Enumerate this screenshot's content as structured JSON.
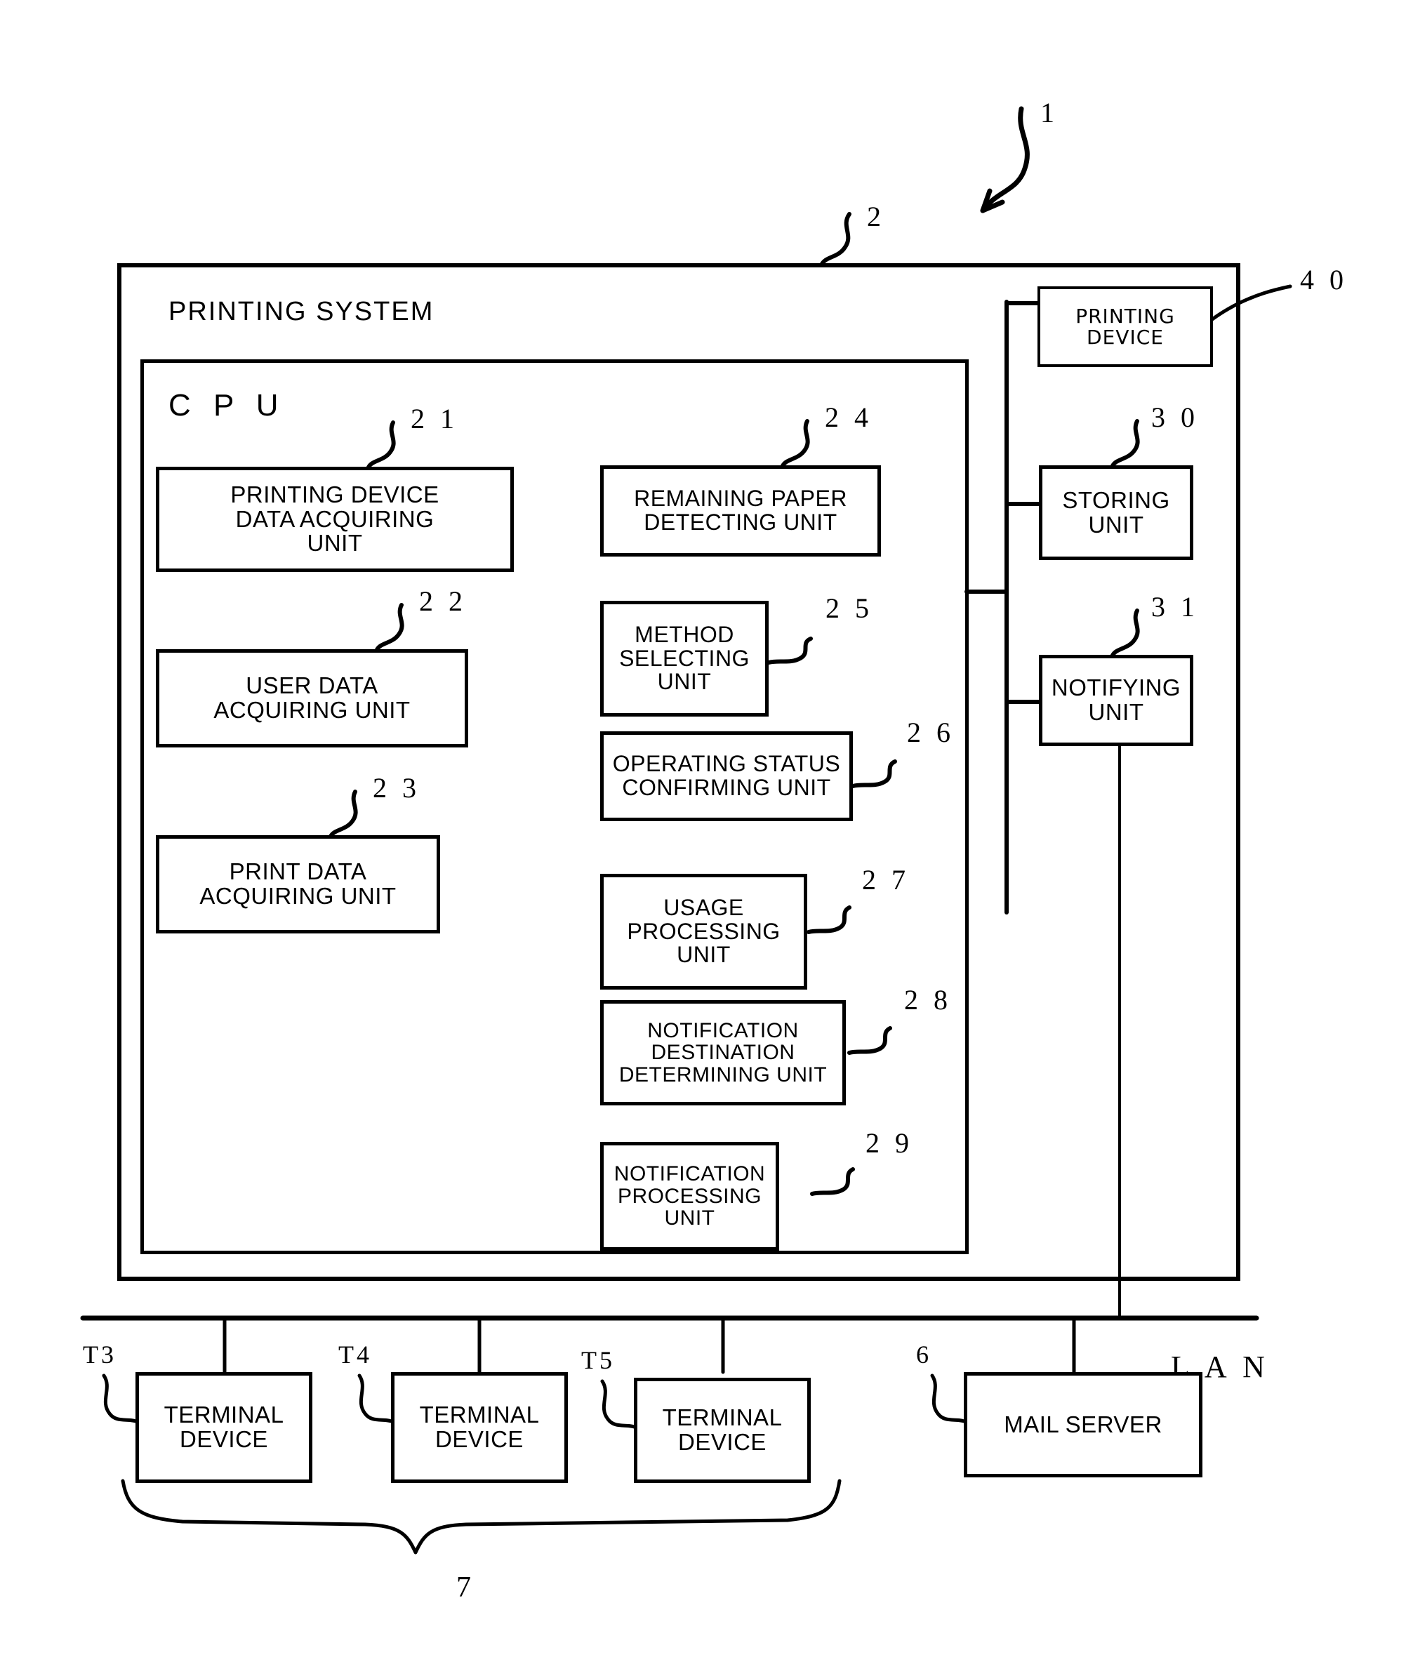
{
  "figure": {
    "system_reference": "1",
    "system_box_reference": "2",
    "printing_system_title": "PRINTING SYSTEM",
    "cpu_title": "C P U",
    "lan_label": "L A N",
    "terminal_group_label": "7",
    "mail_server_reference": "6",
    "printing_device_reference": "4 0",
    "line_color": "#000000",
    "background_color": "#ffffff"
  },
  "cpu_units": {
    "left_column": [
      {
        "ref": "2 1",
        "label": "PRINTING DEVICE\nDATA ACQUIRING\nUNIT"
      },
      {
        "ref": "2 2",
        "label": "USER DATA\nACQUIRING UNIT"
      },
      {
        "ref": "2 3",
        "label": "PRINT DATA\nACQUIRING UNIT"
      }
    ],
    "right_column": [
      {
        "ref": "2 4",
        "label": "REMAINING PAPER\nDETECTING UNIT"
      },
      {
        "ref": "2 5",
        "label": "METHOD\nSELECTING\nUNIT"
      },
      {
        "ref": "2 6",
        "label": "OPERATING STATUS\nCONFIRMING UNIT"
      },
      {
        "ref": "2 7",
        "label": "USAGE\nPROCESSING\nUNIT"
      },
      {
        "ref": "2 8",
        "label": "NOTIFICATION\nDESTINATION\nDETERMINING UNIT"
      },
      {
        "ref": "2 9",
        "label": "NOTIFICATION\nPROCESSING\nUNIT"
      }
    ]
  },
  "peripherals": [
    {
      "ref": "4 0",
      "label": "PRINTING\nDEVICE"
    },
    {
      "ref": "3 0",
      "label": "STORING\nUNIT"
    },
    {
      "ref": "3 1",
      "label": "NOTIFYING\nUNIT"
    }
  ],
  "network_nodes": [
    {
      "ref": "T3",
      "label": "TERMINAL\nDEVICE"
    },
    {
      "ref": "T4",
      "label": "TERMINAL\nDEVICE"
    },
    {
      "ref": "T5",
      "label": "TERMINAL\nDEVICE"
    },
    {
      "ref": "6",
      "label": "MAIL SERVER"
    }
  ]
}
